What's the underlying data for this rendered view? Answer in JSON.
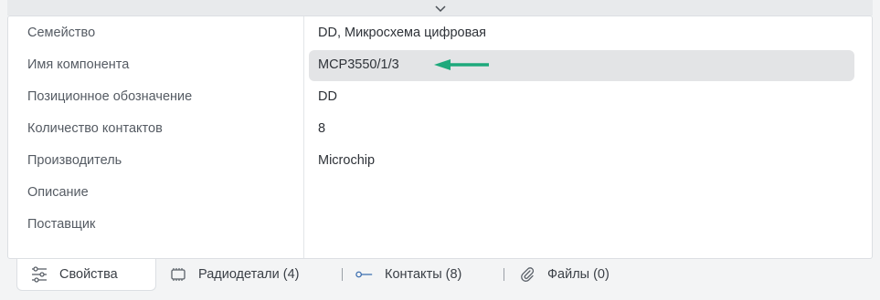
{
  "properties": [
    {
      "label": "Семейство",
      "value": "DD, Микросхема цифровая"
    },
    {
      "label": "Имя компонента",
      "value": "MCP3550/1/3"
    },
    {
      "label": "Позиционное обозначение",
      "value": "DD"
    },
    {
      "label": "Количество контактов",
      "value": "8"
    },
    {
      "label": "Производитель",
      "value": "Microchip"
    },
    {
      "label": "Описание",
      "value": ""
    },
    {
      "label": "Поставщик",
      "value": ""
    }
  ],
  "tabs": [
    {
      "label": "Свойства",
      "icon": "sliders-icon",
      "active": true
    },
    {
      "label": "Радиодетали (4)",
      "icon": "chip-icon",
      "active": false
    },
    {
      "label": "Контакты (8)",
      "icon": "pin-icon",
      "active": false
    },
    {
      "label": "Файлы (0)",
      "icon": "paperclip-icon",
      "active": false
    }
  ],
  "colors": {
    "arrow": "#1ea97c",
    "highlight": "#e3e4e6",
    "panel_bg": "#ffffff",
    "page_bg": "#f3f4f5"
  }
}
